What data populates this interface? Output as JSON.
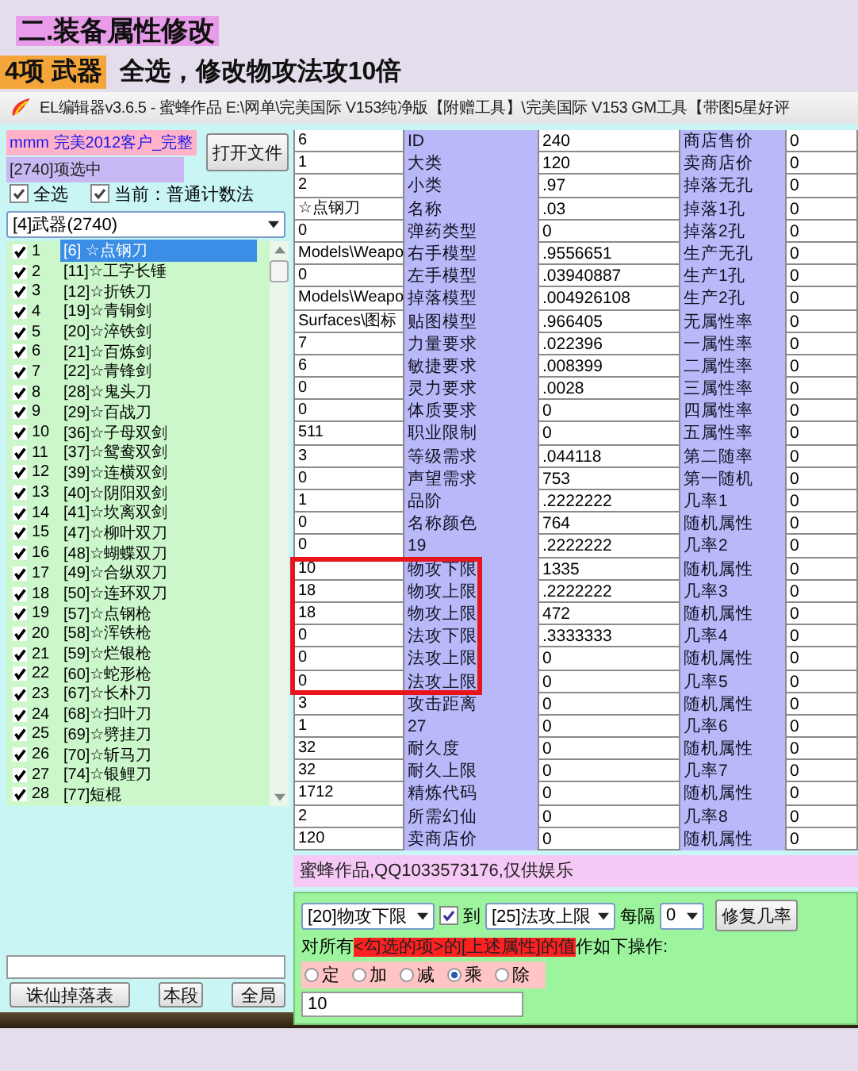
{
  "heading": "二.装备属性修改",
  "subheading": {
    "tag": "4项 武器",
    "text": "全选，修改物攻法攻10倍"
  },
  "window": {
    "title": "EL编辑器v3.6.5  -  蜜蜂作品  E:\\网单\\完美国际 V153纯净版【附赠工具】\\完美国际 V153 GM工具【带图5星好评"
  },
  "left": {
    "file_label": "mmm 完美2012客户_完整",
    "selected_count": "[2740]项选中",
    "open_button": "打开文件",
    "select_all": {
      "label": "全选",
      "checked": true
    },
    "current": {
      "label": "当前：普通计数法",
      "checked": true
    },
    "category": "[4]武器(2740)",
    "items": [
      {
        "no": "1",
        "name": "[6] ☆点钢刀",
        "checked": true,
        "selected": true
      },
      {
        "no": "2",
        "name": "[11]☆工字长锤",
        "checked": true,
        "selected": false
      },
      {
        "no": "3",
        "name": "[12]☆折铁刀",
        "checked": true,
        "selected": false
      },
      {
        "no": "4",
        "name": "[19]☆青铜剑",
        "checked": true,
        "selected": false
      },
      {
        "no": "5",
        "name": "[20]☆淬铁剑",
        "checked": true,
        "selected": false
      },
      {
        "no": "6",
        "name": "[21]☆百炼剑",
        "checked": true,
        "selected": false
      },
      {
        "no": "7",
        "name": "[22]☆青锋剑",
        "checked": true,
        "selected": false
      },
      {
        "no": "8",
        "name": "[28]☆鬼头刀",
        "checked": true,
        "selected": false
      },
      {
        "no": "9",
        "name": "[29]☆百战刀",
        "checked": true,
        "selected": false
      },
      {
        "no": "10",
        "name": "[36]☆子母双剑",
        "checked": true,
        "selected": false
      },
      {
        "no": "11",
        "name": "[37]☆鸳鸯双剑",
        "checked": true,
        "selected": false
      },
      {
        "no": "12",
        "name": "[39]☆连横双剑",
        "checked": true,
        "selected": false
      },
      {
        "no": "13",
        "name": "[40]☆阴阳双剑",
        "checked": true,
        "selected": false
      },
      {
        "no": "14",
        "name": "[41]☆坎离双剑",
        "checked": true,
        "selected": false
      },
      {
        "no": "15",
        "name": "[47]☆柳叶双刀",
        "checked": true,
        "selected": false
      },
      {
        "no": "16",
        "name": "[48]☆蝴蝶双刀",
        "checked": true,
        "selected": false
      },
      {
        "no": "17",
        "name": "[49]☆合纵双刀",
        "checked": true,
        "selected": false
      },
      {
        "no": "18",
        "name": "[50]☆连环双刀",
        "checked": true,
        "selected": false
      },
      {
        "no": "19",
        "name": "[57]☆点钢枪",
        "checked": true,
        "selected": false
      },
      {
        "no": "20",
        "name": "[58]☆浑铁枪",
        "checked": true,
        "selected": false
      },
      {
        "no": "21",
        "name": "[59]☆烂银枪",
        "checked": true,
        "selected": false
      },
      {
        "no": "22",
        "name": "[60]☆蛇形枪",
        "checked": true,
        "selected": false
      },
      {
        "no": "23",
        "name": "[67]☆长朴刀",
        "checked": true,
        "selected": false
      },
      {
        "no": "24",
        "name": "[68]☆扫叶刀",
        "checked": true,
        "selected": false
      },
      {
        "no": "25",
        "name": "[69]☆劈挂刀",
        "checked": true,
        "selected": false
      },
      {
        "no": "26",
        "name": "[70]☆斩马刀",
        "checked": true,
        "selected": false
      },
      {
        "no": "27",
        "name": "[74]☆银鲤刀",
        "checked": true,
        "selected": false
      },
      {
        "no": "28",
        "name": "[77]短棍",
        "checked": true,
        "selected": false
      }
    ],
    "buttons": [
      "诛仙掉落表",
      "本段",
      "全局"
    ]
  },
  "table": {
    "rows": [
      {
        "value_1": "6",
        "label_1": "ID",
        "value_2": "240",
        "label_2": "商店售价",
        "value_3": "0",
        "boxed": false
      },
      {
        "value_1": "1",
        "label_1": "大类",
        "value_2": "120",
        "label_2": "卖商店价",
        "value_3": "0",
        "boxed": false
      },
      {
        "value_1": "2",
        "label_1": "小类",
        "value_2": ".97",
        "label_2": "掉落无孔",
        "value_3": "0",
        "boxed": false
      },
      {
        "value_1": "☆点钢刀",
        "label_1": "名称",
        "value_2": ".03",
        "label_2": "掉落1孔",
        "value_3": "0",
        "boxed": false
      },
      {
        "value_1": "0",
        "label_1": "弹药类型",
        "value_2": "0",
        "label_2": "掉落2孔",
        "value_3": "0",
        "boxed": false
      },
      {
        "value_1": "Models\\Weapo",
        "label_1": "右手模型",
        "value_2": ".9556651",
        "label_2": "生产无孔",
        "value_3": "0",
        "boxed": false
      },
      {
        "value_1": "0",
        "label_1": "左手模型",
        "value_2": ".03940887",
        "label_2": "生产1孔",
        "value_3": "0",
        "boxed": false
      },
      {
        "value_1": "Models\\Weapo",
        "label_1": "掉落模型",
        "value_2": ".004926108",
        "label_2": "生产2孔",
        "value_3": "0",
        "boxed": false
      },
      {
        "value_1": "Surfaces\\图标",
        "label_1": "贴图模型",
        "value_2": ".966405",
        "label_2": "无属性率",
        "value_3": "0",
        "boxed": false
      },
      {
        "value_1": "7",
        "label_1": "力量要求",
        "value_2": ".022396",
        "label_2": "一属性率",
        "value_3": "0",
        "boxed": false
      },
      {
        "value_1": "6",
        "label_1": "敏捷要求",
        "value_2": ".008399",
        "label_2": "二属性率",
        "value_3": "0",
        "boxed": false
      },
      {
        "value_1": "0",
        "label_1": "灵力要求",
        "value_2": ".0028",
        "label_2": "三属性率",
        "value_3": "0",
        "boxed": false
      },
      {
        "value_1": "0",
        "label_1": "体质要求",
        "value_2": "0",
        "label_2": "四属性率",
        "value_3": "0",
        "boxed": false
      },
      {
        "value_1": "511",
        "label_1": "职业限制",
        "value_2": "0",
        "label_2": "五属性率",
        "value_3": "0",
        "boxed": false
      },
      {
        "value_1": "3",
        "label_1": "等级需求",
        "value_2": ".044118",
        "label_2": "第二随率",
        "value_3": "0",
        "boxed": false
      },
      {
        "value_1": "0",
        "label_1": "声望需求",
        "value_2": "753",
        "label_2": "第一随机",
        "value_3": "0",
        "boxed": false
      },
      {
        "value_1": "1",
        "label_1": "品阶",
        "value_2": ".2222222",
        "label_2": "几率1",
        "value_3": "0",
        "boxed": false
      },
      {
        "value_1": "0",
        "label_1": "名称颜色",
        "value_2": "764",
        "label_2": "随机属性",
        "value_3": "0",
        "boxed": false
      },
      {
        "value_1": "0",
        "label_1": "19",
        "value_2": ".2222222",
        "label_2": "几率2",
        "value_3": "0",
        "boxed": false
      },
      {
        "value_1": "10",
        "label_1": "物攻下限",
        "value_2": "1335",
        "label_2": "随机属性",
        "value_3": "0",
        "boxed": true
      },
      {
        "value_1": "18",
        "label_1": "物攻上限",
        "value_2": ".2222222",
        "label_2": "几率3",
        "value_3": "0",
        "boxed": true
      },
      {
        "value_1": "18",
        "label_1": "物攻上限",
        "value_2": "472",
        "label_2": "随机属性",
        "value_3": "0",
        "boxed": true
      },
      {
        "value_1": "0",
        "label_1": "法攻下限",
        "value_2": ".3333333",
        "label_2": "几率4",
        "value_3": "0",
        "boxed": true
      },
      {
        "value_1": "0",
        "label_1": "法攻上限",
        "value_2": "0",
        "label_2": "随机属性",
        "value_3": "0",
        "boxed": true
      },
      {
        "value_1": "0",
        "label_1": "法攻上限",
        "value_2": "0",
        "label_2": "几率5",
        "value_3": "0",
        "boxed": true
      },
      {
        "value_1": "3",
        "label_1": "攻击距离",
        "value_2": "0",
        "label_2": "随机属性",
        "value_3": "0",
        "boxed": false
      },
      {
        "value_1": "1",
        "label_1": "27",
        "value_2": "0",
        "label_2": "几率6",
        "value_3": "0",
        "boxed": false
      },
      {
        "value_1": "32",
        "label_1": "耐久度",
        "value_2": "0",
        "label_2": "随机属性",
        "value_3": "0",
        "boxed": false
      },
      {
        "value_1": "32",
        "label_1": "耐久上限",
        "value_2": "0",
        "label_2": "几率7",
        "value_3": "0",
        "boxed": false
      },
      {
        "value_1": "1712",
        "label_1": "精炼代码",
        "value_2": "0",
        "label_2": "随机属性",
        "value_3": "0",
        "boxed": false
      },
      {
        "value_1": "2",
        "label_1": "所需幻仙",
        "value_2": "0",
        "label_2": "几率8",
        "value_3": "0",
        "boxed": false
      },
      {
        "value_1": "120",
        "label_1": "卖商店价",
        "value_2": "0",
        "label_2": "随机属性",
        "value_3": "0",
        "boxed": false
      }
    ]
  },
  "note": "蜜蜂作品,QQ1033573176,仅供娱乐",
  "ops": {
    "from": "[20]物攻下限",
    "range": {
      "label": "到",
      "checked": true
    },
    "to": "[25]法攻上限",
    "every_label": "每隔",
    "every": "0",
    "fix_button": "修复几率",
    "sentence": [
      {
        "text": "对所有",
        "highlight": false
      },
      {
        "text": "<勾选的项>的[上述属性]的值",
        "highlight": true
      },
      {
        "text": "作如下操作:",
        "highlight": false
      }
    ],
    "modes": [
      {
        "label": "定",
        "selected": false
      },
      {
        "label": "加",
        "selected": false
      },
      {
        "label": "减",
        "selected": false
      },
      {
        "label": "乘",
        "selected": true
      },
      {
        "label": "除",
        "selected": false
      }
    ],
    "amount": "10"
  }
}
